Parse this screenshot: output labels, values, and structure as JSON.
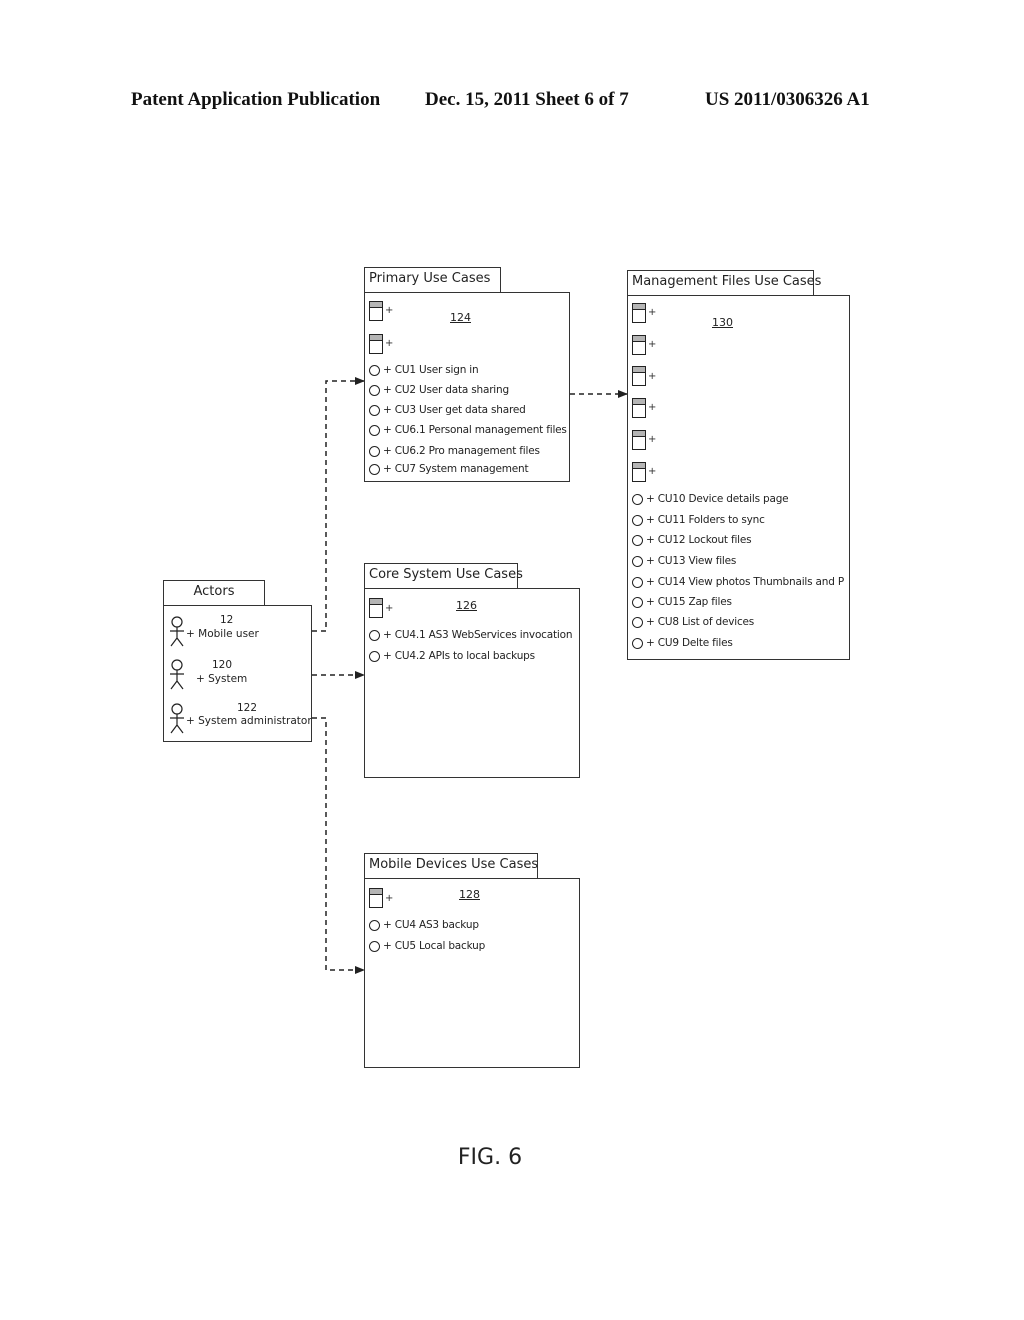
{
  "header": {
    "publication": "Patent Application Publication",
    "date_sheet": "Dec. 15, 2011   Sheet 6 of 7",
    "patent_number": "US 2011/0306326 A1"
  },
  "packages": {
    "primary": {
      "title": "Primary Use Cases",
      "ref": "124",
      "class_count": 2,
      "use_cases": [
        "+ CU1 User sign in",
        "+ CU2 User data sharing",
        "+ CU3 User get data shared",
        "+ CU6.1 Personal management files",
        "+ CU6.2 Pro management files",
        "+ CU7 System management"
      ]
    },
    "management": {
      "title": "Management Files Use Cases",
      "ref": "130",
      "class_count": 6,
      "use_cases": [
        "+ CU10 Device details page",
        "+ CU11 Folders to sync",
        "+ CU12 Lockout files",
        "+ CU13 View files",
        "+ CU14 View photos Thumbnails and P",
        "+ CU15 Zap files",
        "+ CU8 List of devices",
        "+ CU9 Delte files"
      ]
    },
    "actors": {
      "title": "Actors",
      "items": [
        {
          "ref": "12",
          "label": "+ Mobile user"
        },
        {
          "ref": "120",
          "label": "+ System"
        },
        {
          "ref": "122",
          "label": "+ System administrator"
        }
      ]
    },
    "core": {
      "title": "Core System Use Cases",
      "ref": "126",
      "class_count": 1,
      "use_cases": [
        "+ CU4.1 AS3 WebServices invocation",
        "+ CU4.2 APIs to local backups"
      ]
    },
    "mobile": {
      "title": "Mobile Devices Use Cases",
      "ref": "128",
      "class_count": 1,
      "use_cases": [
        "+ CU4 AS3 backup",
        "+ CU5 Local backup"
      ]
    }
  },
  "class_plus": "+",
  "figure_label": "FIG. 6"
}
